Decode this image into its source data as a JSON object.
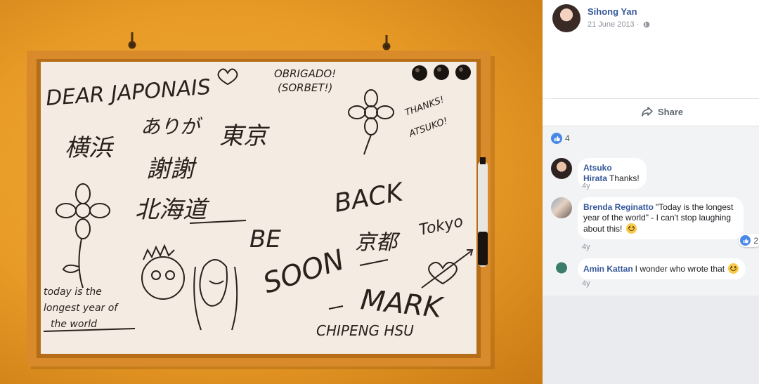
{
  "post": {
    "author": "Sihong Yan",
    "date": "21 June 2013 ·",
    "privacy_icon": "globe-icon"
  },
  "actions": {
    "share_label": "Share",
    "share_icon": "share-arrow-icon"
  },
  "reactions": {
    "icon": "like-icon",
    "count": "4"
  },
  "comments": [
    {
      "name": "Atsuko Hirata",
      "text": "Thanks!",
      "time": "4y"
    },
    {
      "name": "Brenda Reginatto",
      "text": "\"Today is the longest year of the world\" - I can't stop laughing about this!",
      "emoji": "smile-emoji",
      "time": "4y",
      "reaction_count": "2"
    },
    {
      "name": "Amin Kattan",
      "text": "I wonder who wrote that",
      "emoji": "smile-emoji",
      "time": "4y"
    }
  ],
  "whiteboard": {
    "lines": [
      "DEAR JAPONAIS",
      "OBRIGADO!",
      "(SORBET!)",
      "THANKS!",
      "ATSUKO!",
      "ありが",
      "東京",
      "横浜",
      "謝謝",
      "北海道",
      "BACK",
      "BE",
      "SOON",
      "京都",
      "Tokyo",
      "MARK",
      "CHIPENG HSU",
      "today is the",
      "longest year of",
      "the world"
    ]
  },
  "colors": {
    "link": "#365899",
    "wall": "#e89a26",
    "frame": "#d98a2b",
    "board": "#f4ece3"
  }
}
